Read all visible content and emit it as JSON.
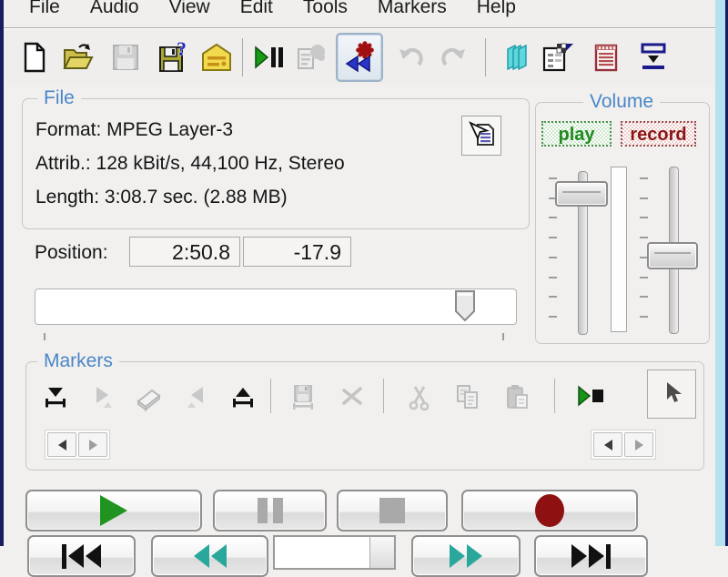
{
  "menu": {
    "items": [
      "File",
      "Audio",
      "View",
      "Edit",
      "Tools",
      "Markers",
      "Help"
    ]
  },
  "toolbar": {
    "buttons": [
      "new-file",
      "open-file",
      "save-file",
      "save-as",
      "batch-list",
      "play-pause",
      "file-properties",
      "record-rewind",
      "undo",
      "redo",
      "vu-meter",
      "settings",
      "id3-notepad",
      "dock-layout"
    ],
    "disabled_buttons": [
      "save-file",
      "file-properties",
      "undo",
      "redo"
    ],
    "active_button": "record-rewind"
  },
  "file_group": {
    "legend": "File",
    "format_line": "Format: MPEG Layer-3",
    "attrib_line": "Attrib.: 128 kBit/s, 44,100 Hz, Stereo",
    "length_line": "Length: 3:08.7 sec. (2.88 MB)",
    "info_icon": "file-info-cursor-icon"
  },
  "position": {
    "label": "Position:",
    "time_value": "2:50.8",
    "level_value": "-17.9",
    "slider_percent": 87
  },
  "volume": {
    "legend": "Volume",
    "play_label": "play",
    "record_label": "record",
    "play_fader_percent_from_top": 8,
    "record_fader_percent_from_top": 50
  },
  "markers": {
    "legend": "Markers",
    "buttons": [
      "add-marker",
      "next-marker",
      "erase-marker",
      "prev-marker",
      "pop-marker",
      "save-selection",
      "delete-selection",
      "cut",
      "copy",
      "paste",
      "play-selection",
      "cursor-mode"
    ],
    "disabled_buttons": [
      "next-marker",
      "erase-marker",
      "prev-marker",
      "save-selection",
      "delete-selection",
      "cut",
      "copy",
      "paste"
    ]
  },
  "transport": {
    "row1_buttons": [
      "play",
      "pause",
      "stop",
      "record"
    ],
    "row2_buttons": [
      "skip-to-start",
      "rewind",
      "speed-combo",
      "fast-forward",
      "skip-to-end"
    ]
  },
  "colors": {
    "accent_blue": "#4a86c8",
    "play_green": "#1f8a1f",
    "record_red": "#8a1616",
    "teal_arrows": "#2aa79b",
    "window_border_navy": "#191c5e",
    "window_border_cyan": "#b4e2ef"
  }
}
